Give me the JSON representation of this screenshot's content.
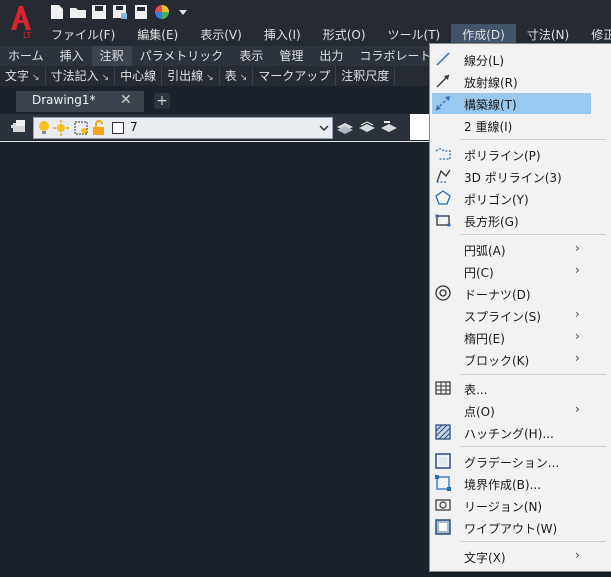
{
  "menubar": {
    "items": [
      "ファイル(F)",
      "編集(E)",
      "表示(V)",
      "挿入(I)",
      "形式(O)",
      "ツール(T)",
      "作成(D)",
      "寸法(N)",
      "修正(M)"
    ],
    "active_index": 6
  },
  "ribbon": {
    "tabs": [
      "ホーム",
      "挿入",
      "注釈",
      "パラメトリック",
      "表示",
      "管理",
      "出力",
      "コラボレート"
    ],
    "active_index": 2,
    "panels": [
      "文字",
      "寸法記入",
      "中心線",
      "引出線",
      "表",
      "マークアップ",
      "注釈尺度"
    ]
  },
  "document": {
    "tab_label": "Drawing1*",
    "close_glyph": "✕",
    "new_tab_glyph": "+"
  },
  "layer": {
    "current": "7"
  },
  "draw_menu": {
    "items": [
      {
        "label": "線分(L)",
        "icon": "line-icon",
        "submenu": false
      },
      {
        "label": "放射線(R)",
        "icon": "ray-icon",
        "submenu": false
      },
      {
        "label": "構築線(T)",
        "icon": "construction-line-icon",
        "submenu": false,
        "highlighted": true
      },
      {
        "label": "2 重線(I)",
        "icon": "",
        "submenu": false
      },
      {
        "label": "ポリライン(P)",
        "icon": "polyline-icon",
        "submenu": false
      },
      {
        "label": "3D ポリライン(3)",
        "icon": "3d-polyline-icon",
        "submenu": false
      },
      {
        "label": "ポリゴン(Y)",
        "icon": "polygon-icon",
        "submenu": false
      },
      {
        "label": "長方形(G)",
        "icon": "rectangle-icon",
        "submenu": false
      },
      {
        "label": "円弧(A)",
        "icon": "",
        "submenu": true
      },
      {
        "label": "円(C)",
        "icon": "",
        "submenu": true
      },
      {
        "label": "ドーナツ(D)",
        "icon": "donut-icon",
        "submenu": false
      },
      {
        "label": "スプライン(S)",
        "icon": "",
        "submenu": true
      },
      {
        "label": "楕円(E)",
        "icon": "",
        "submenu": true
      },
      {
        "label": "ブロック(K)",
        "icon": "",
        "submenu": true
      },
      {
        "label": "表...",
        "icon": "table-icon",
        "submenu": false
      },
      {
        "label": "点(O)",
        "icon": "",
        "submenu": true
      },
      {
        "label": "ハッチング(H)...",
        "icon": "hatch-icon",
        "submenu": false
      },
      {
        "label": "グラデーション...",
        "icon": "gradient-icon",
        "submenu": false
      },
      {
        "label": "境界作成(B)...",
        "icon": "boundary-icon",
        "submenu": false
      },
      {
        "label": "リージョン(N)",
        "icon": "region-icon",
        "submenu": false
      },
      {
        "label": "ワイプアウト(W)",
        "icon": "wipeout-icon",
        "submenu": false
      },
      {
        "label": "文字(X)",
        "icon": "",
        "submenu": true
      }
    ],
    "arrow_glyph": "›"
  },
  "colors": {
    "accent": "#99c9ef",
    "menu_active": "#41546a",
    "canvas": "#1c222c"
  }
}
